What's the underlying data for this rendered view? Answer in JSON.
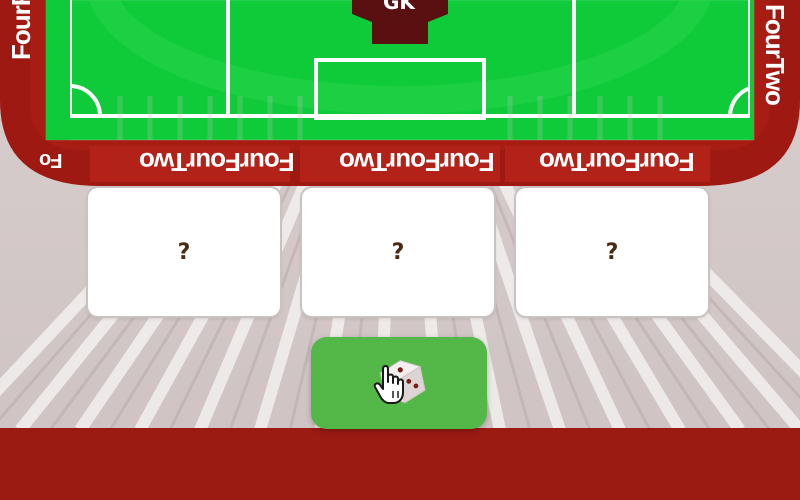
{
  "brand": {
    "banner_text": "FourFourTwo",
    "side_left_text": "FourFo",
    "side_right_text": "FourTwo",
    "edge_text": "Fo"
  },
  "pitch": {
    "position_label": "GK",
    "colors": {
      "grass": "#0fcb3a",
      "grass_light": "#2dd24a",
      "line": "#ffffff",
      "border": "#a71d14",
      "jersey": "#5a1010"
    }
  },
  "slots": [
    {
      "value": "?"
    },
    {
      "value": "?"
    },
    {
      "value": "?"
    }
  ],
  "roll_button": {
    "icon": "dice-icon",
    "cursor_icon": "hand-pointer-icon",
    "color": "#53b848"
  },
  "colors": {
    "stand_red": "#9b1a12",
    "stand_light": "#ded7d7",
    "card_bg": "#ffffff",
    "question_mark": "#4a2a12"
  }
}
